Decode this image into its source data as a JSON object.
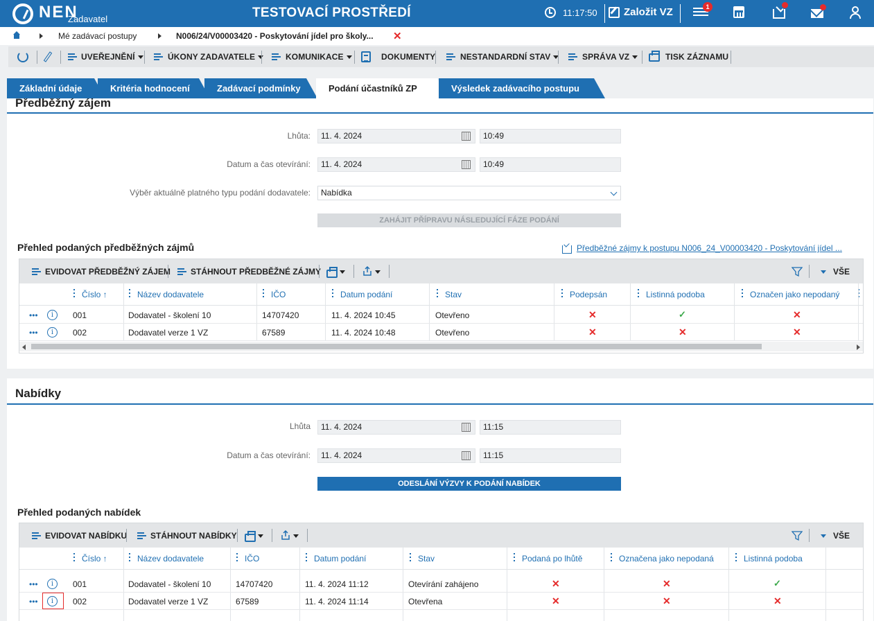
{
  "header": {
    "logo": "NEN",
    "logo_sub": "Zadavatel",
    "env_title": "TESTOVACÍ PROSTŘEDÍ",
    "time": "11:17:50",
    "create_label": "Založit VZ",
    "notif_count": "1",
    "brand_color": "#1f6fb2"
  },
  "breadcrumb": {
    "items": [
      "Mé zadávací postupy",
      "N006/24/V00003420 - Poskytování jídel pro školy..."
    ],
    "close": "✕"
  },
  "toolbar": {
    "items": [
      {
        "label": "UVEŘEJNĚNÍ"
      },
      {
        "label": "ÚKONY ZADAVATELE"
      },
      {
        "label": "KOMUNIKACE"
      },
      {
        "label": "DOKUMENTY"
      },
      {
        "label": "NESTANDARDNÍ STAV"
      },
      {
        "label": "SPRÁVA VZ"
      },
      {
        "label": "TISK ZÁZNAMU"
      }
    ]
  },
  "tabs": [
    {
      "label": "Základní údaje"
    },
    {
      "label": "Kritéria hodnocení"
    },
    {
      "label": "Zadávací podmínky"
    },
    {
      "label": "Podání účastníků ZP"
    },
    {
      "label": "Výsledek zadávacího postupu"
    }
  ],
  "section1": {
    "title": "Předběžný zájem",
    "lhuta_label": "Lhůta:",
    "lhuta_date": "11. 4. 2024",
    "lhuta_time": "10:49",
    "open_label": "Datum a čas otevírání:",
    "open_date": "11. 4. 2024",
    "open_time": "10:49",
    "type_label": "Výběr aktuálně platného typu podání dodavatele:",
    "type_value": "Nabídka",
    "button": "ZAHÁJIT PŘÍPRAVU NÁSLEDUJÍCÍ FÁZE PODÁNÍ",
    "overview_title": "Přehled podaných předběžných zájmů",
    "link": "Předběžné zájmy k postupu N006_24_V00003420 - Poskytování jídel ...",
    "grid": {
      "tb_evid": "EVIDOVAT PŘEDBĚŽNÝ ZÁJEM",
      "tb_dl": "STÁHNOUT PŘEDBĚŽNÉ ZÁJMY",
      "tb_all": "VŠE",
      "headers": [
        "Číslo ↑",
        "Název dodavatele",
        "IČO",
        "Datum podání",
        "Stav",
        "Podepsán",
        "Listinná podoba",
        "Označen jako nepodaný"
      ],
      "rows": [
        {
          "num": "001",
          "name": "Dodavatel - školení 10",
          "ico": "14707420",
          "date": "11. 4. 2024 10:45",
          "stav": "Otevřeno",
          "podepsan": "✕",
          "listinna": "✓",
          "oznacen": "✕"
        },
        {
          "num": "002",
          "name": "Dodavatel verze 1 VZ",
          "ico": "67589",
          "date": "11. 4. 2024 10:48",
          "stav": "Otevřeno",
          "podepsan": "✕",
          "listinna": "✕",
          "oznacen": "✕"
        }
      ]
    }
  },
  "section2": {
    "title": "Nabídky",
    "lhuta_label": "Lhůta",
    "lhuta_date": "11. 4. 2024",
    "lhuta_time": "11:15",
    "open_label": "Datum a čas otevírání:",
    "open_date": "11. 4. 2024",
    "open_time": "11:15",
    "button": "ODESLÁNÍ VÝZVY K PODÁNÍ NABÍDEK",
    "overview_title": "Přehled podaných nabídek",
    "grid": {
      "tb_evid": "EVIDOVAT NABÍDKU",
      "tb_dl": "STÁHNOUT NABÍDKY",
      "tb_all": "VŠE",
      "headers": [
        "Číslo ↑",
        "Název dodavatele",
        "IČO",
        "Datum podání",
        "Stav",
        "Podaná po lhůtě",
        "Označena jako nepodaná",
        "Listinná podoba"
      ],
      "rows": [
        {
          "num": "001",
          "name": "Dodavatel - školení 10",
          "ico": "14707420",
          "date": "11. 4. 2024 11:12",
          "stav": "Otevírání zahájeno",
          "po_lhute": "✕",
          "oznacena": "✕",
          "listinna": "✓"
        },
        {
          "num": "002",
          "name": "Dodavatel verze 1 VZ",
          "ico": "67589",
          "date": "11. 4. 2024 11:14",
          "stav": "Otevřena",
          "po_lhute": "✕",
          "oznacena": "✕",
          "listinna": "✕"
        }
      ]
    }
  },
  "icons": {
    "row_menu": "•••",
    "info": "i"
  }
}
